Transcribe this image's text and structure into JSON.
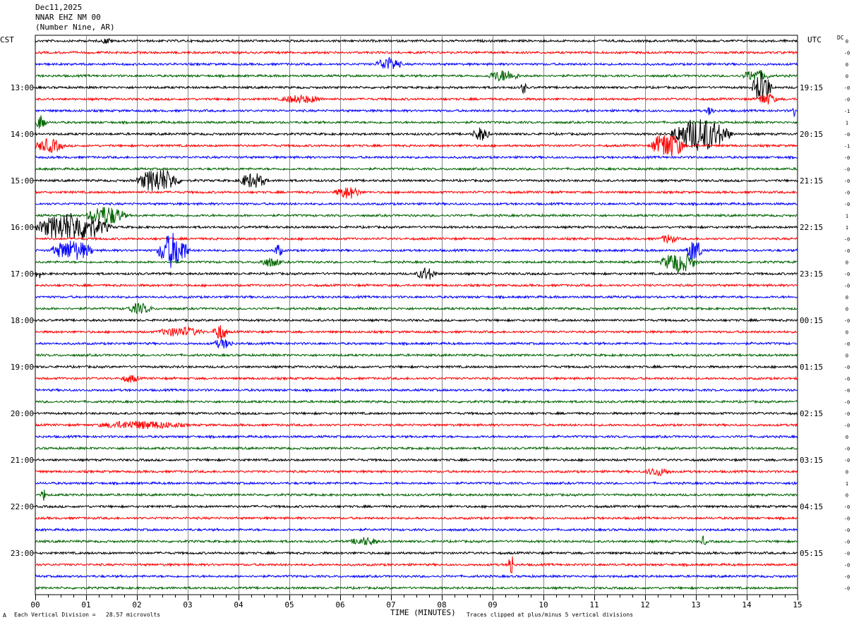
{
  "header": {
    "date": "Dec11,2025",
    "station": "NNAR EHZ NM 00",
    "location": "(Number Nine, AR)"
  },
  "left_timezone": "CST",
  "right_timezone": "UTC",
  "dc_label": "DC",
  "chart_data": {
    "type": "line",
    "title": "",
    "xlabel": "TIME (MINUTES)",
    "xticks": [
      "00",
      "01",
      "02",
      "03",
      "04",
      "05",
      "06",
      "07",
      "08",
      "09",
      "10",
      "11",
      "12",
      "13",
      "14",
      "15"
    ],
    "xlim": [
      0,
      15
    ],
    "trace_colors": [
      "#000000",
      "#ff0000",
      "#0000ff",
      "#006400"
    ],
    "rows_per_hour": 4,
    "left_hour_labels": [
      "13:00",
      "14:00",
      "15:00",
      "16:00",
      "17:00",
      "18:00",
      "19:00",
      "20:00",
      "21:00",
      "22:00",
      "23:00"
    ],
    "right_hour_labels": [
      "19:15",
      "20:15",
      "21:15",
      "22:15",
      "23:15",
      "00:15",
      "01:15",
      "02:15",
      "03:15",
      "04:15",
      "05:15"
    ],
    "dc_offsets": [
      "0",
      "-0",
      "0",
      "0",
      "-0",
      "-0",
      "-1",
      "1",
      "-0",
      "-1",
      "-0",
      "-0",
      "-0",
      "-0",
      "-0",
      "1",
      "1",
      "-0",
      "-0",
      "0",
      "-0",
      "-0",
      "0",
      "0",
      "-0",
      "0",
      "-0",
      "0",
      "-0",
      "-0",
      "-0",
      "-0",
      "-0",
      "-0",
      "0",
      "-0",
      "-0",
      "0",
      "1",
      "0",
      "-0",
      "-0",
      "-0",
      "-0",
      "-0",
      "-0",
      "-0",
      "-0"
    ],
    "events": [
      {
        "row": 0,
        "start": 1.3,
        "end": 1.7,
        "amp": 0.2
      },
      {
        "row": 2,
        "start": 6.7,
        "end": 7.6,
        "amp": 0.55
      },
      {
        "row": 3,
        "start": 8.9,
        "end": 10.0,
        "amp": 0.45
      },
      {
        "row": 3,
        "start": 13.9,
        "end": 14.9,
        "amp": 0.45
      },
      {
        "row": 4,
        "start": 9.55,
        "end": 9.75,
        "amp": 0.5
      },
      {
        "row": 4,
        "start": 14.1,
        "end": 14.8,
        "amp": 1.3
      },
      {
        "row": 5,
        "start": 4.8,
        "end": 6.3,
        "amp": 0.3
      },
      {
        "row": 5,
        "start": 14.2,
        "end": 14.9,
        "amp": 0.45
      },
      {
        "row": 6,
        "start": 13.2,
        "end": 13.5,
        "amp": 0.35
      },
      {
        "row": 6,
        "start": 14.9,
        "end": 15.0,
        "amp": 0.5
      },
      {
        "row": 7,
        "start": 0.0,
        "end": 0.4,
        "amp": 0.6
      },
      {
        "row": 8,
        "start": 8.6,
        "end": 9.2,
        "amp": 0.55
      },
      {
        "row": 8,
        "start": 12.5,
        "end": 14.6,
        "amp": 1.4
      },
      {
        "row": 9,
        "start": 0.0,
        "end": 1.0,
        "amp": 0.55
      },
      {
        "row": 9,
        "start": 12.1,
        "end": 13.3,
        "amp": 1.1
      },
      {
        "row": 12,
        "start": 2.0,
        "end": 3.5,
        "amp": 1.0
      },
      {
        "row": 12,
        "start": 4.0,
        "end": 5.0,
        "amp": 0.6
      },
      {
        "row": 13,
        "start": 5.9,
        "end": 6.8,
        "amp": 0.5
      },
      {
        "row": 15,
        "start": 1.0,
        "end": 2.4,
        "amp": 0.8
      },
      {
        "row": 16,
        "start": 0.0,
        "end": 2.6,
        "amp": 1.2
      },
      {
        "row": 17,
        "start": 12.3,
        "end": 12.9,
        "amp": 0.35
      },
      {
        "row": 18,
        "start": 0.3,
        "end": 1.8,
        "amp": 0.85
      },
      {
        "row": 18,
        "start": 2.4,
        "end": 3.5,
        "amp": 1.5
      },
      {
        "row": 18,
        "start": 4.7,
        "end": 5.0,
        "amp": 0.5
      },
      {
        "row": 18,
        "start": 12.8,
        "end": 13.4,
        "amp": 0.9
      },
      {
        "row": 19,
        "start": 4.4,
        "end": 5.2,
        "amp": 0.35
      },
      {
        "row": 19,
        "start": 12.3,
        "end": 13.6,
        "amp": 0.85
      },
      {
        "row": 20,
        "start": 0.0,
        "end": 0.2,
        "amp": 0.5
      },
      {
        "row": 20,
        "start": 7.5,
        "end": 8.2,
        "amp": 0.5
      },
      {
        "row": 23,
        "start": 1.8,
        "end": 2.7,
        "amp": 0.4
      },
      {
        "row": 25,
        "start": 2.4,
        "end": 4.0,
        "amp": 0.35
      },
      {
        "row": 25,
        "start": 3.5,
        "end": 4.0,
        "amp": 0.7
      },
      {
        "row": 26,
        "start": 3.5,
        "end": 4.2,
        "amp": 0.35
      },
      {
        "row": 29,
        "start": 1.7,
        "end": 2.3,
        "amp": 0.3
      },
      {
        "row": 33,
        "start": 1.2,
        "end": 4.3,
        "amp": 0.3
      },
      {
        "row": 37,
        "start": 12.0,
        "end": 12.9,
        "amp": 0.3
      },
      {
        "row": 38,
        "start": 14.9,
        "end": 15.0,
        "amp": 0.4
      },
      {
        "row": 39,
        "start": 0.1,
        "end": 0.3,
        "amp": 0.5
      },
      {
        "row": 43,
        "start": 6.2,
        "end": 7.2,
        "amp": 0.3
      },
      {
        "row": 43,
        "start": 13.1,
        "end": 13.3,
        "amp": 0.4
      },
      {
        "row": 45,
        "start": 9.3,
        "end": 9.5,
        "amp": 1.2
      }
    ]
  },
  "footer": {
    "scale_note": "Each Vertical Division =   28.57 microvolts",
    "clip_note": "Traces clipped at plus/minus 5 vertical divisions",
    "corner_mark": "A"
  }
}
